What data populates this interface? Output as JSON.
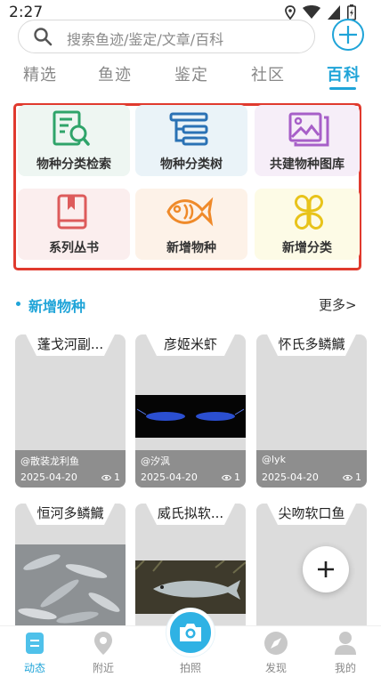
{
  "status_bar": {
    "time": "2:27"
  },
  "search": {
    "placeholder": "搜索鱼迹/鉴定/文章/百科"
  },
  "tabs": [
    {
      "label": "精选"
    },
    {
      "label": "鱼迹"
    },
    {
      "label": "鉴定"
    },
    {
      "label": "社区"
    },
    {
      "label": "百科",
      "active": true
    }
  ],
  "categories": [
    {
      "label": "物种分类检索",
      "icon": "document-search-icon",
      "bg": "#eef6f2",
      "color": "#2fa46a"
    },
    {
      "label": "物种分类树",
      "icon": "tree-structure-icon",
      "bg": "#eaf3f8",
      "color": "#2a72b5"
    },
    {
      "label": "共建物种图库",
      "icon": "image-gallery-icon",
      "bg": "#f6eef8",
      "color": "#a75fc8"
    },
    {
      "label": "系列丛书",
      "icon": "book-icon",
      "bg": "#fbeeee",
      "color": "#dd5b5b"
    },
    {
      "label": "新增物种",
      "icon": "fish-icon",
      "bg": "#fdf2e8",
      "color": "#ef8a2a"
    },
    {
      "label": "新增分类",
      "icon": "clover-icon",
      "bg": "#fdfbe6",
      "color": "#e8c31a"
    }
  ],
  "section": {
    "title": "新增物种",
    "more": "更多>"
  },
  "species": [
    {
      "title": "蓬戈河副...",
      "author": "@散装龙利鱼",
      "date": "2025-04-20",
      "views": "1"
    },
    {
      "title": "彦姬米虾",
      "author": "@汐沨",
      "date": "2025-04-20",
      "views": "1"
    },
    {
      "title": "怀氏多鳞鱵",
      "author": "@lyk",
      "date": "2025-04-20",
      "views": "1"
    },
    {
      "title": "恒河多鳞鱵"
    },
    {
      "title": "威氏拟软..."
    },
    {
      "title": "尖吻软口鱼"
    }
  ],
  "bottom_nav": [
    {
      "label": "动态",
      "icon": "feed-icon",
      "active": true
    },
    {
      "label": "附近",
      "icon": "location-pin-icon"
    },
    {
      "label": "拍照",
      "icon": "camera-icon"
    },
    {
      "label": "发现",
      "icon": "compass-icon"
    },
    {
      "label": "我的",
      "icon": "user-icon"
    }
  ],
  "colors": {
    "accent": "#1fa4d8",
    "highlight_border": "#e03a2e"
  }
}
